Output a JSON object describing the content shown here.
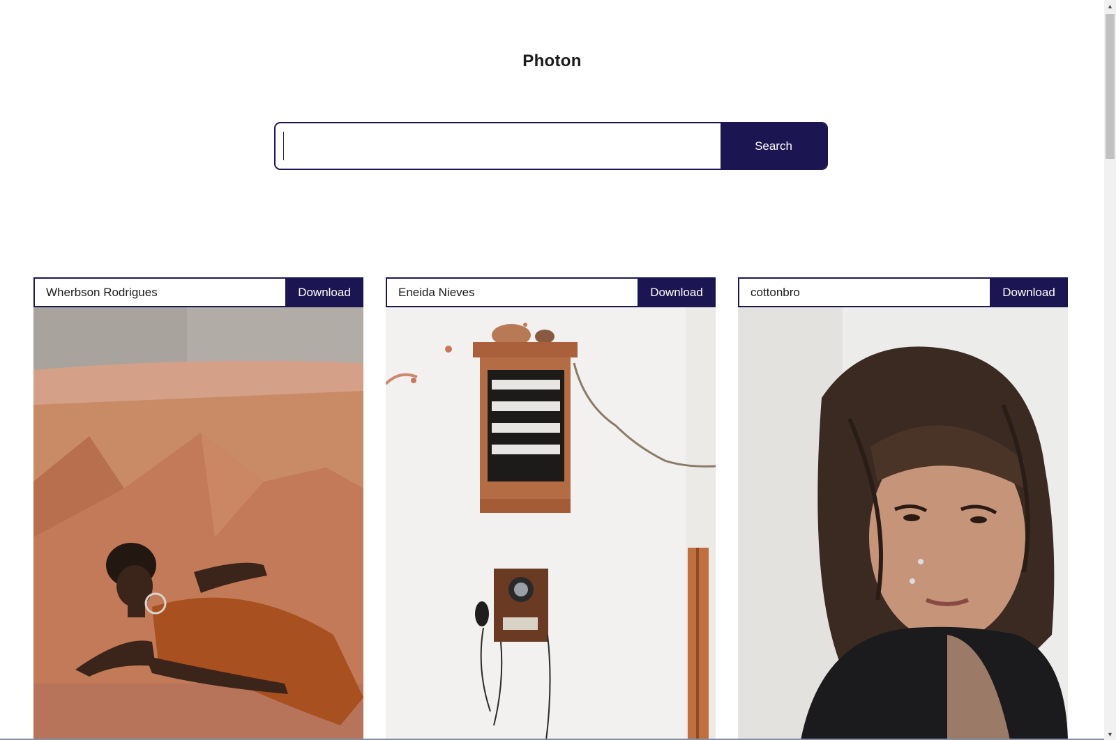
{
  "app": {
    "title": "Photon"
  },
  "search": {
    "value": "",
    "placeholder": "",
    "button_label": "Search"
  },
  "photos": [
    {
      "author": "Wherbson Rodrigues",
      "download_label": "Download",
      "image": "woman lying against orange geometric wall"
    },
    {
      "author": "Eneida Nieves",
      "download_label": "Download",
      "image": "vintage wooden wall telephone and switchboard"
    },
    {
      "author": "cottonbro",
      "download_label": "Download",
      "image": "portrait of woman with curly windblown hair"
    }
  ],
  "colors": {
    "accent": "#1b1551",
    "background": "#ffffff"
  },
  "icons": {
    "scroll_up": "chevron-up-icon",
    "scroll_down": "chevron-down-icon"
  }
}
